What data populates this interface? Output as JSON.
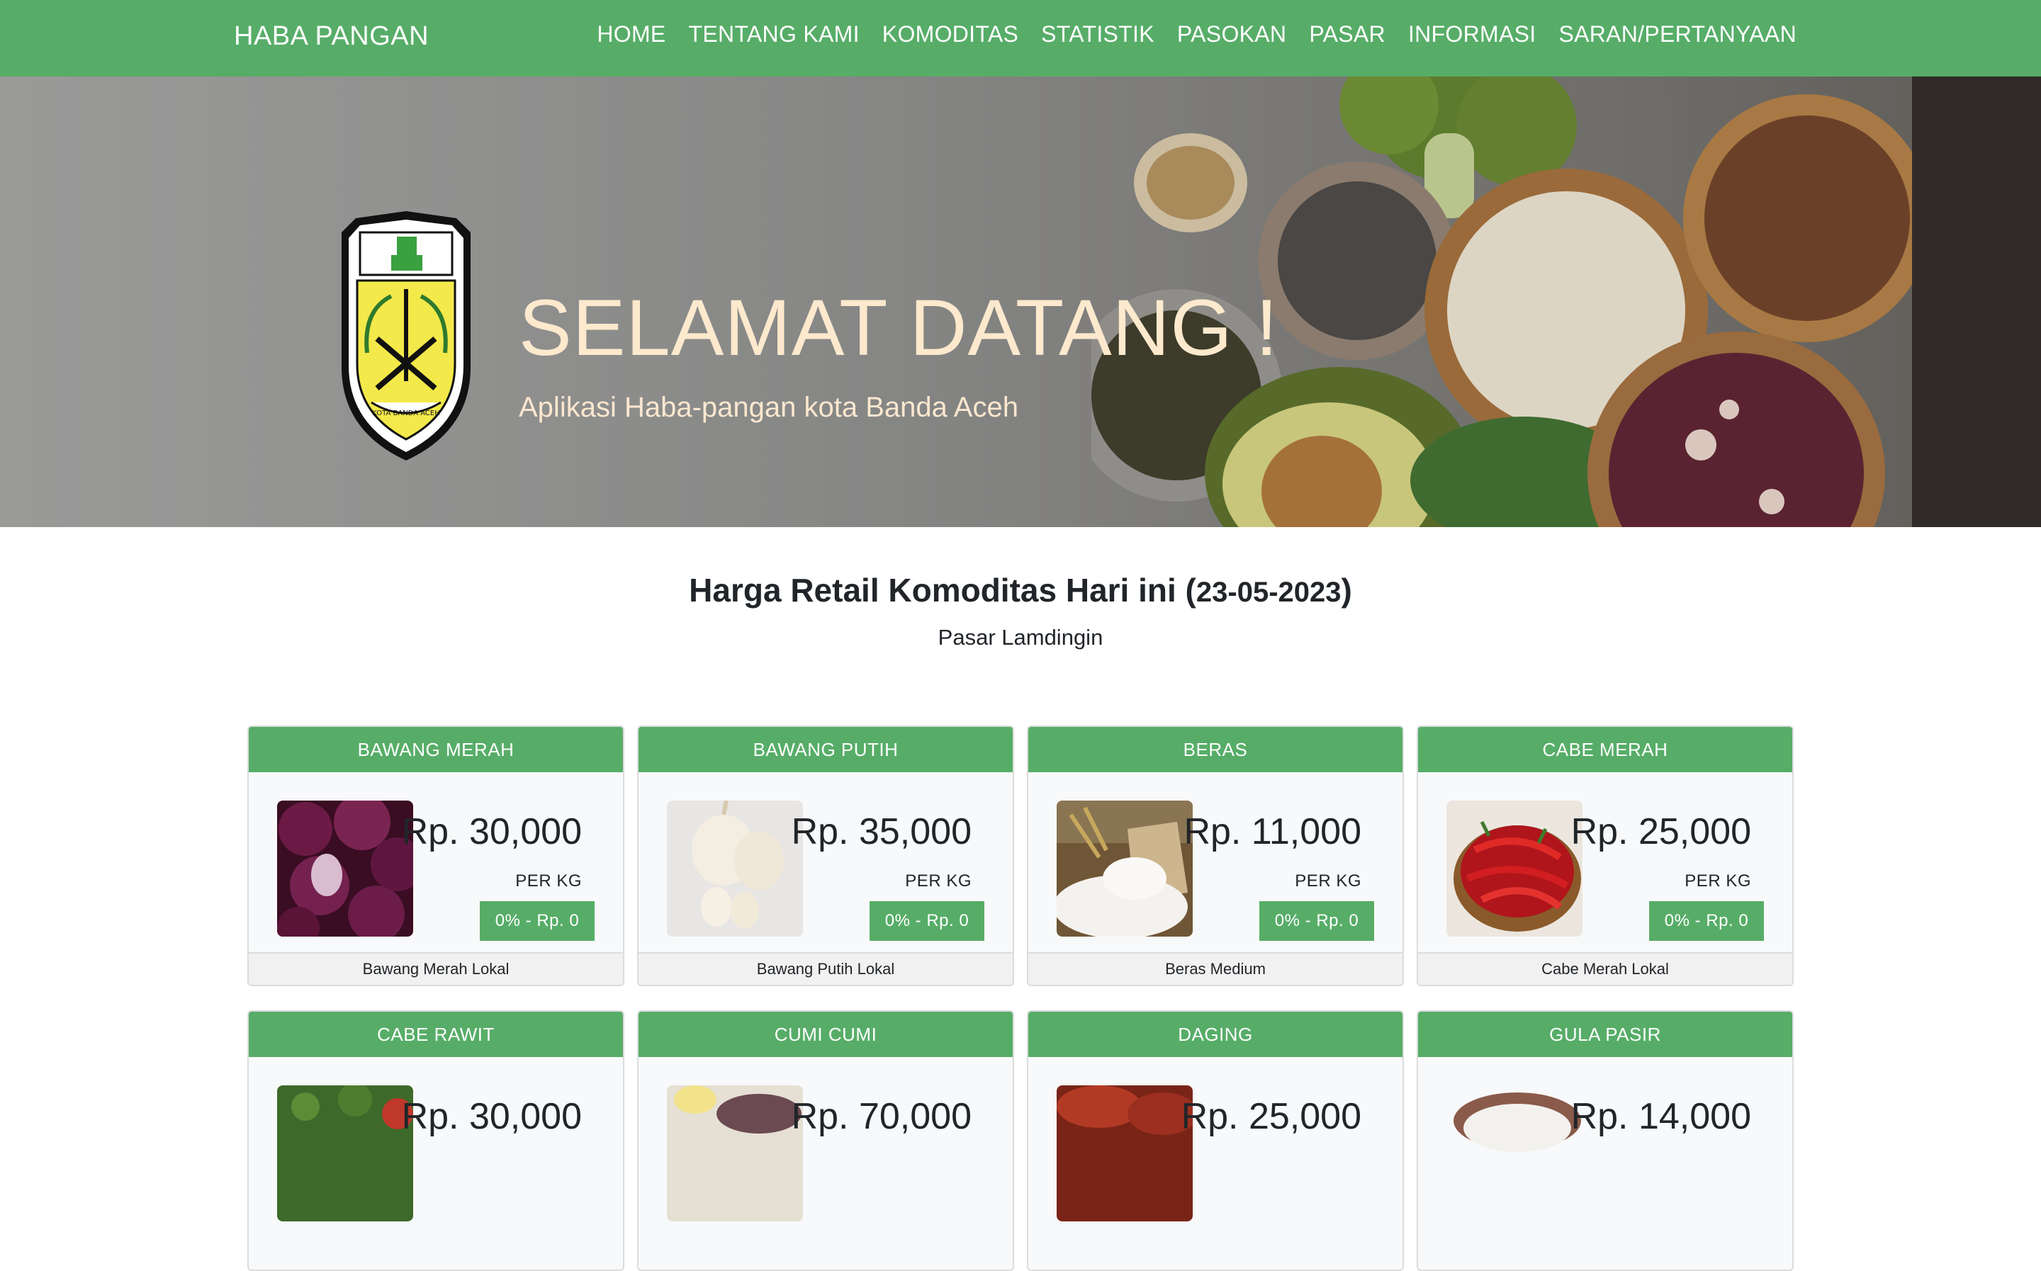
{
  "navbar": {
    "brand": "HABA PANGAN",
    "links": [
      "HOME",
      "TENTANG KAMI",
      "KOMODITAS",
      "STATISTIK",
      "PASOKAN",
      "PASAR",
      "INFORMASI",
      "SARAN/PERTANYAAN"
    ]
  },
  "hero": {
    "title": "SELAMAT DATANG !",
    "subtitle": "Aplikasi Haba-pangan kota Banda Aceh",
    "logo_text": "KOTA BANDA ACEH"
  },
  "section": {
    "heading": "Harga Retail Komoditas Hari ini",
    "date": "23-05-2023",
    "market": "Pasar Lamdingin"
  },
  "cards": [
    {
      "name": "BAWANG MERAH",
      "price": "Rp. 30,000",
      "unit": "PER KG",
      "change": "0% - Rp. 0",
      "desc": "Bawang Merah Lokal",
      "image": "red-onion-photo"
    },
    {
      "name": "BAWANG PUTIH",
      "price": "Rp. 35,000",
      "unit": "PER KG",
      "change": "0% - Rp. 0",
      "desc": "Bawang Putih Lokal",
      "image": "garlic-photo"
    },
    {
      "name": "BERAS",
      "price": "Rp. 11,000",
      "unit": "PER KG",
      "change": "0% - Rp. 0",
      "desc": "Beras Medium",
      "image": "rice-photo"
    },
    {
      "name": "CABE MERAH",
      "price": "Rp. 25,000",
      "unit": "PER KG",
      "change": "0% - Rp. 0",
      "desc": "Cabe Merah Lokal",
      "image": "red-chili-photo"
    },
    {
      "name": "CABE RAWIT",
      "price": "Rp. 30,000",
      "image": "bird-chili-photo"
    },
    {
      "name": "CUMI CUMI",
      "price": "Rp. 70,000",
      "image": "squid-photo"
    },
    {
      "name": "DAGING",
      "price": "Rp. 25,000",
      "image": "meat-photo"
    },
    {
      "name": "GULA PASIR",
      "price": "Rp. 14,000",
      "image": "sugar-photo"
    }
  ],
  "colors": {
    "primary_green": "#57ad68",
    "hero_title": "#fde9cd",
    "card_bg": "#f8f9fa"
  }
}
